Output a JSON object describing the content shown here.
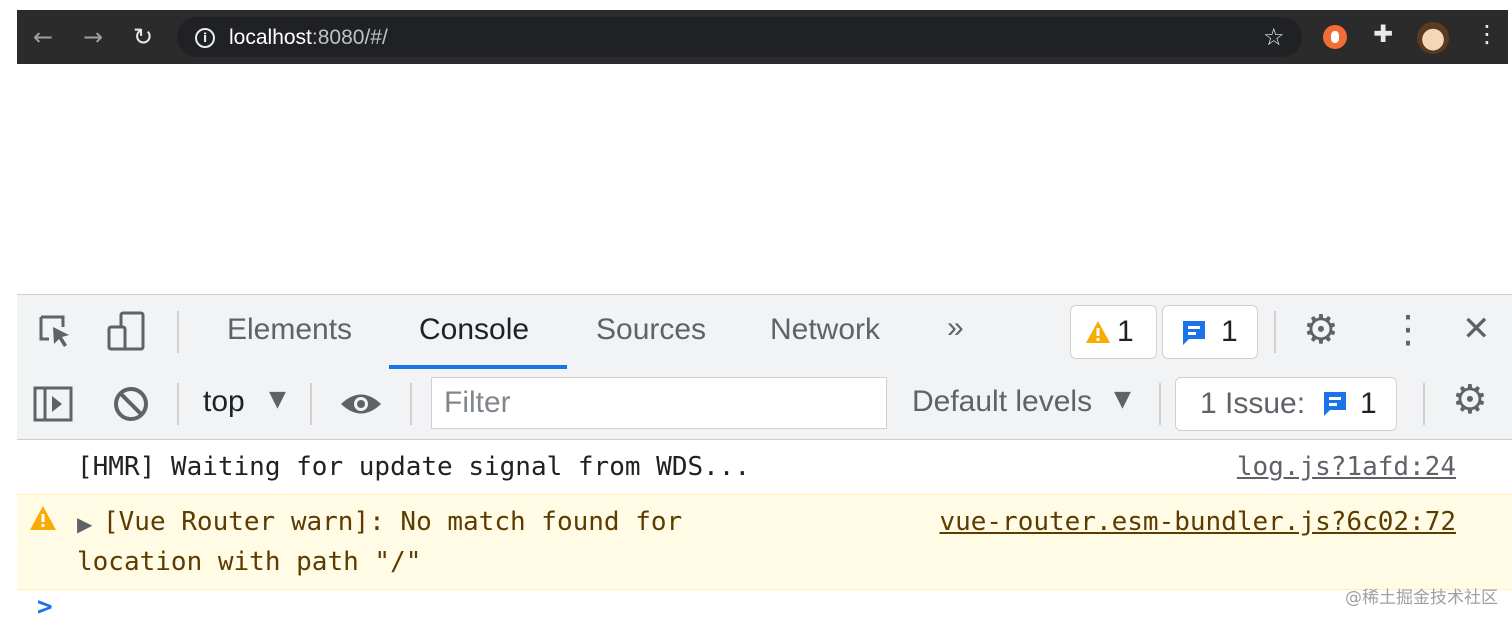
{
  "browser": {
    "url_host": "localhost",
    "url_rest": ":8080/#/",
    "icons": {
      "back": "arrow-left-icon",
      "forward": "arrow-right-icon",
      "reload": "reload-icon",
      "info": "info-icon",
      "bookmark": "star-icon",
      "extension": "extension-icon",
      "extensions_menu": "puzzle-icon",
      "profile": "avatar",
      "menu": "kebab-menu-icon"
    }
  },
  "devtools": {
    "tabs": [
      {
        "label": "Elements"
      },
      {
        "label": "Console",
        "active": true
      },
      {
        "label": "Sources"
      },
      {
        "label": "Network"
      }
    ],
    "more_tabs": "»",
    "warning_count": "1",
    "message_count": "1",
    "toolbar": {
      "context": "top",
      "filter_placeholder": "Filter",
      "levels": "Default levels",
      "issues_label": "1 Issue:",
      "issues_count": "1"
    },
    "console": {
      "messages": [
        {
          "type": "log",
          "text": "[HMR] Waiting for update signal from WDS...",
          "source": "log.js?1afd:24"
        },
        {
          "type": "warning",
          "line1": "[Vue Router warn]: No match found for",
          "line2": "location with path \"/\"",
          "source": "vue-router.esm-bundler.js?6c02:72"
        }
      ],
      "prompt": ">"
    }
  },
  "watermark": "@稀土掘金技术社区",
  "colors": {
    "accent": "#1a73e8",
    "warning_bg": "#fffbe5",
    "warning_icon": "#f9ab00",
    "toolbar_bg": "#f1f3f4",
    "browser_bar": "#2b2b2b"
  }
}
